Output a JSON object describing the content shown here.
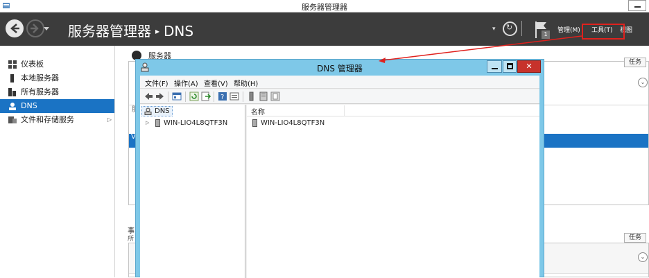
{
  "window": {
    "title": "服务器管理器",
    "breadcrumb": [
      "服务器管理器",
      "DNS"
    ],
    "breadcrumb_separator": "▸",
    "notification_count": "1",
    "menu": {
      "manage": "管理(M)",
      "tools": "工具(T)",
      "view": "视图"
    },
    "highlight_color": "#e0211d"
  },
  "sidebar": {
    "items": [
      {
        "label": "仪表板",
        "icon": "dashboard-icon"
      },
      {
        "label": "本地服务器",
        "icon": "local-server-icon"
      },
      {
        "label": "所有服务器",
        "icon": "all-servers-icon"
      },
      {
        "label": "DNS",
        "icon": "dns-icon",
        "selected": true
      },
      {
        "label": "文件和存储服务",
        "icon": "file-storage-icon",
        "has_submenu": true
      }
    ],
    "selected_color": "#1a73c4"
  },
  "content": {
    "servers_heading": "服务器",
    "tasks_label": "任务",
    "events_heading": "事",
    "events_sub": "所",
    "panel1_fragment": "服",
    "row_fragment": "V"
  },
  "dns_window": {
    "title": "DNS 管理器",
    "close_label": "✕",
    "menus": [
      "文件(F)",
      "操作(A)",
      "查看(V)",
      "帮助(H)"
    ],
    "toolbar_icons": [
      "back-icon",
      "forward-icon",
      "console-tree-icon",
      "refresh-icon",
      "export-icon",
      "help-icon",
      "properties-icon",
      "server-icon",
      "server-list-icon",
      "server-group-icon"
    ],
    "tree": {
      "root": "DNS",
      "children": [
        "WIN-LIO4L8QTF3N"
      ]
    },
    "list": {
      "columns": [
        "名称"
      ],
      "rows": [
        "WIN-LIO4L8QTF3N"
      ]
    }
  }
}
